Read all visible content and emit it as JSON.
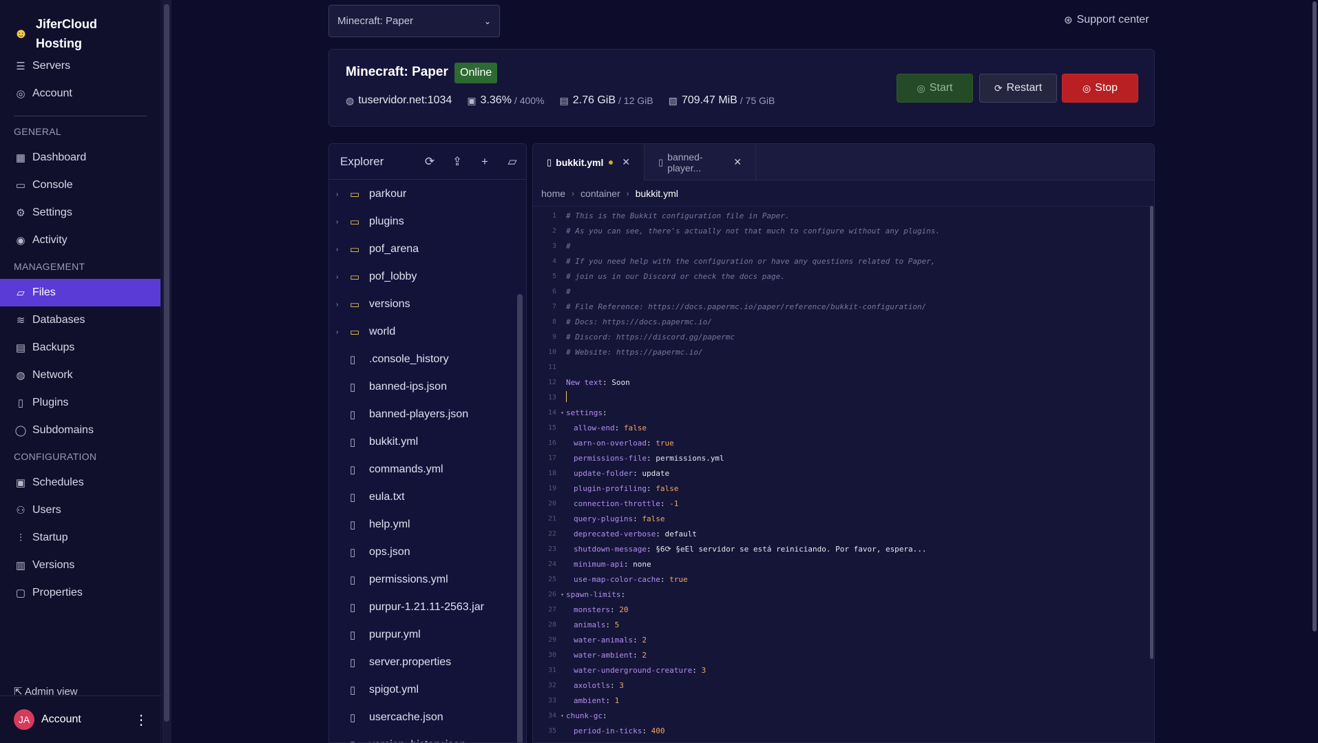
{
  "brand": {
    "logo_icon": "jifercloud-logo-icon",
    "name": "JiferCloud Hosting"
  },
  "nav_top": [
    {
      "label": "Servers",
      "icon": "server-icon",
      "glyph": "☰"
    },
    {
      "label": "Account",
      "icon": "user-circle-icon",
      "glyph": "◎"
    }
  ],
  "sections": {
    "general": {
      "title": "GENERAL",
      "items": [
        {
          "label": "Dashboard",
          "icon": "grid-icon",
          "glyph": "▦"
        },
        {
          "label": "Console",
          "icon": "terminal-icon",
          "glyph": "▭"
        },
        {
          "label": "Settings",
          "icon": "gear-icon",
          "glyph": "⚙"
        },
        {
          "label": "Activity",
          "icon": "eye-icon",
          "glyph": "◉"
        }
      ]
    },
    "management": {
      "title": "MANAGEMENT",
      "items": [
        {
          "label": "Files",
          "icon": "folder-open-icon",
          "glyph": "▱",
          "active": true
        },
        {
          "label": "Databases",
          "icon": "database-icon",
          "glyph": "≋"
        },
        {
          "label": "Backups",
          "icon": "archive-icon",
          "glyph": "▤"
        },
        {
          "label": "Network",
          "icon": "network-icon",
          "glyph": "◍"
        },
        {
          "label": "Plugins",
          "icon": "plugin-icon",
          "glyph": "▯"
        },
        {
          "label": "Subdomains",
          "icon": "globe-icon",
          "glyph": "◯"
        }
      ]
    },
    "configuration": {
      "title": "CONFIGURATION",
      "items": [
        {
          "label": "Schedules",
          "icon": "calendar-icon",
          "glyph": "▣"
        },
        {
          "label": "Users",
          "icon": "users-icon",
          "glyph": "⚇"
        },
        {
          "label": "Startup",
          "icon": "sliders-icon",
          "glyph": "⫶"
        },
        {
          "label": "Versions",
          "icon": "package-icon",
          "glyph": "▥"
        },
        {
          "label": "Properties",
          "icon": "file-text-icon",
          "glyph": "▢"
        }
      ]
    }
  },
  "admin_view": "Admin view",
  "account": {
    "initials": "JA",
    "label": "Account"
  },
  "server_select": {
    "value": "Minecraft: Paper"
  },
  "support": {
    "label": "Support center"
  },
  "server": {
    "name": "Minecraft: Paper",
    "status": "Online",
    "address": "tuservidor.net:1034",
    "cpu": "3.36%",
    "cpu_limit": "/ 400%",
    "memory": "2.76 GiB",
    "memory_limit": "/ 12 GiB",
    "disk": "709.47 MiB",
    "disk_limit": "/ 75 GiB"
  },
  "buttons": {
    "start": "Start",
    "restart": "Restart",
    "stop": "Stop"
  },
  "explorer": {
    "title": "Explorer",
    "files": [
      {
        "name": "parkour",
        "type": "folder"
      },
      {
        "name": "plugins",
        "type": "folder"
      },
      {
        "name": "pof_arena",
        "type": "folder"
      },
      {
        "name": "pof_lobby",
        "type": "folder"
      },
      {
        "name": "versions",
        "type": "folder"
      },
      {
        "name": "world",
        "type": "folder"
      },
      {
        "name": ".console_history",
        "type": "file"
      },
      {
        "name": "banned-ips.json",
        "type": "file"
      },
      {
        "name": "banned-players.json",
        "type": "file"
      },
      {
        "name": "bukkit.yml",
        "type": "file"
      },
      {
        "name": "commands.yml",
        "type": "file"
      },
      {
        "name": "eula.txt",
        "type": "file"
      },
      {
        "name": "help.yml",
        "type": "file"
      },
      {
        "name": "ops.json",
        "type": "file"
      },
      {
        "name": "permissions.yml",
        "type": "file"
      },
      {
        "name": "purpur-1.21.11-2563.jar",
        "type": "file"
      },
      {
        "name": "purpur.yml",
        "type": "file"
      },
      {
        "name": "server.properties",
        "type": "file"
      },
      {
        "name": "spigot.yml",
        "type": "file"
      },
      {
        "name": "usercache.json",
        "type": "file"
      },
      {
        "name": "version_history.json",
        "type": "file"
      }
    ]
  },
  "tabs": [
    {
      "label": "bukkit.yml",
      "modified": true,
      "active": true
    },
    {
      "label": "banned-player...",
      "modified": false,
      "active": false
    }
  ],
  "breadcrumb": [
    "home",
    "container",
    "bukkit.yml"
  ],
  "code_lines": [
    {
      "n": "1",
      "indent": 0,
      "comment": "# This is the Bukkit configuration file in Paper."
    },
    {
      "n": "2",
      "indent": 0,
      "comment": "# As you can see, there's actually not that much to configure without any plugins."
    },
    {
      "n": "3",
      "indent": 0,
      "comment": "#"
    },
    {
      "n": "4",
      "indent": 0,
      "comment": "# If you need help with the configuration or have any questions related to Paper,"
    },
    {
      "n": "5",
      "indent": 0,
      "comment": "# join us in our Discord or check the docs page."
    },
    {
      "n": "6",
      "indent": 0,
      "comment": "#"
    },
    {
      "n": "7",
      "indent": 0,
      "comment": "# File Reference: https://docs.papermc.io/paper/reference/bukkit-configuration/"
    },
    {
      "n": "8",
      "indent": 0,
      "comment": "# Docs: https://docs.papermc.io/"
    },
    {
      "n": "9",
      "indent": 0,
      "comment": "# Discord: https://discord.gg/papermc"
    },
    {
      "n": "10",
      "indent": 0,
      "comment": "# Website: https://papermc.io/"
    },
    {
      "n": "11",
      "indent": 0
    },
    {
      "n": "12",
      "indent": 0,
      "key": "New text",
      "val": "Soon",
      "vtype": "str"
    },
    {
      "n": "13",
      "indent": 0,
      "cursor": true
    },
    {
      "n": "14",
      "indent": 0,
      "key": "settings",
      "fold": true
    },
    {
      "n": "15",
      "indent": 1,
      "key": "allow-end",
      "val": "false",
      "vtype": "bool"
    },
    {
      "n": "16",
      "indent": 1,
      "key": "warn-on-overload",
      "val": "true",
      "vtype": "bool"
    },
    {
      "n": "17",
      "indent": 1,
      "key": "permissions-file",
      "val": "permissions.yml",
      "vtype": "str"
    },
    {
      "n": "18",
      "indent": 1,
      "key": "update-folder",
      "val": "update",
      "vtype": "str"
    },
    {
      "n": "19",
      "indent": 1,
      "key": "plugin-profiling",
      "val": "false",
      "vtype": "bool"
    },
    {
      "n": "20",
      "indent": 1,
      "key": "connection-throttle",
      "val": "-1",
      "vtype": "num"
    },
    {
      "n": "21",
      "indent": 1,
      "key": "query-plugins",
      "val": "false",
      "vtype": "bool"
    },
    {
      "n": "22",
      "indent": 1,
      "key": "deprecated-verbose",
      "val": "default",
      "vtype": "str"
    },
    {
      "n": "23",
      "indent": 1,
      "key": "shutdown-message",
      "val": "§6⟳ §eEl servidor se está reiniciando. Por favor, espera...",
      "vtype": "str"
    },
    {
      "n": "24",
      "indent": 1,
      "key": "minimum-api",
      "val": "none",
      "vtype": "str"
    },
    {
      "n": "25",
      "indent": 1,
      "key": "use-map-color-cache",
      "val": "true",
      "vtype": "bool"
    },
    {
      "n": "26",
      "indent": 0,
      "key": "spawn-limits",
      "fold": true
    },
    {
      "n": "27",
      "indent": 1,
      "key": "monsters",
      "val": "20",
      "vtype": "num"
    },
    {
      "n": "28",
      "indent": 1,
      "key": "animals",
      "val": "5",
      "vtype": "num"
    },
    {
      "n": "29",
      "indent": 1,
      "key": "water-animals",
      "val": "2",
      "vtype": "num"
    },
    {
      "n": "30",
      "indent": 1,
      "key": "water-ambient",
      "val": "2",
      "vtype": "num"
    },
    {
      "n": "31",
      "indent": 1,
      "key": "water-underground-creature",
      "val": "3",
      "vtype": "num"
    },
    {
      "n": "32",
      "indent": 1,
      "key": "axolotls",
      "val": "3",
      "vtype": "num"
    },
    {
      "n": "33",
      "indent": 1,
      "key": "ambient",
      "val": "1",
      "vtype": "num"
    },
    {
      "n": "34",
      "indent": 0,
      "key": "chunk-gc",
      "fold": true
    },
    {
      "n": "35",
      "indent": 1,
      "key": "period-in-ticks",
      "val": "400",
      "vtype": "num"
    }
  ],
  "colors": {
    "accent": "#5b3bd6",
    "online": "#2d6a32",
    "stop": "#b82023",
    "start": "#244a26"
  }
}
